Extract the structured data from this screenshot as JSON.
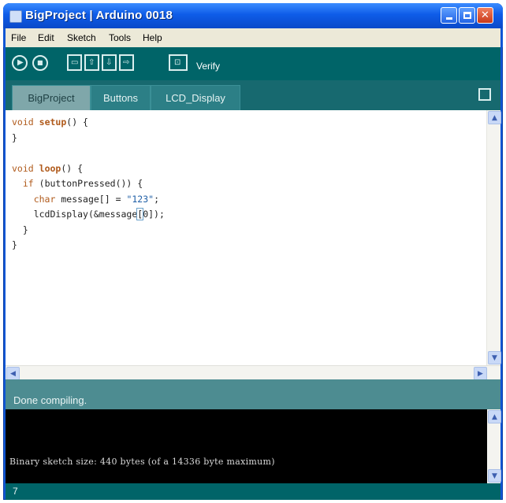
{
  "window": {
    "title": "BigProject | Arduino 0018"
  },
  "menu": [
    "File",
    "Edit",
    "Sketch",
    "Tools",
    "Help"
  ],
  "toolbar": {
    "buttons": [
      "verify",
      "stop",
      "new",
      "open",
      "save",
      "upload",
      "serial-monitor"
    ],
    "hover_label": "Verify"
  },
  "tabs": [
    "BigProject",
    "Buttons",
    "LCD_Display"
  ],
  "code": {
    "line1_kw": "void",
    "line1_fn": "setup",
    "line1_rest": "() {",
    "line2": "}",
    "line4_kw": "void",
    "line4_fn": "loop",
    "line4_rest": "() {",
    "line5_kw": "if",
    "line5_rest": "(buttonPressed()) {",
    "line6_kw": "char",
    "line6_mid": "message[] = ",
    "line6_str": "\"123\"",
    "line6_end": ";",
    "line7_pre": "lcdDisplay(&message",
    "line7_bracket": "[",
    "line7_post": "0]);",
    "line8": "}",
    "line9": "}"
  },
  "status": {
    "message": "Done compiling."
  },
  "console": {
    "output": "Binary sketch size: 440 bytes (of a 14336 byte maximum)"
  },
  "footer": {
    "line_number": "7"
  },
  "colors": {
    "toolbar": "#006468",
    "status": "#4d8c91",
    "keyword": "#b05a1b",
    "string": "#1f5fa6"
  }
}
